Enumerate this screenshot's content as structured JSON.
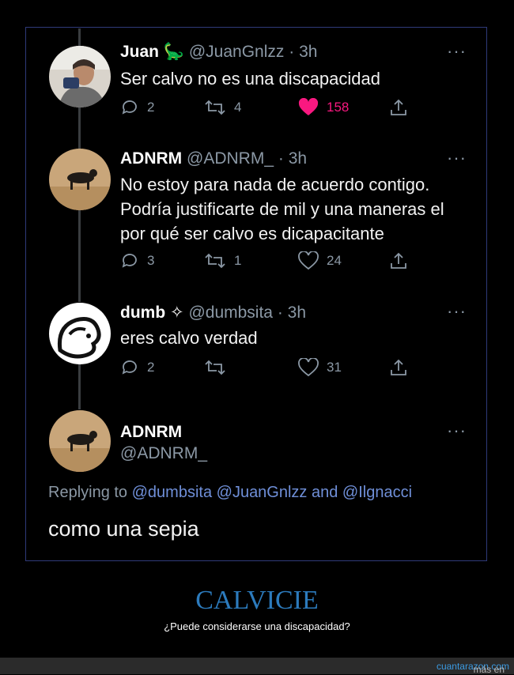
{
  "tweets": [
    {
      "name": "Juan",
      "badge": "🦕",
      "handle": "@JuanGnlzz",
      "time": "3h",
      "text": [
        "Ser calvo no es una discapacidad"
      ],
      "replies": "2",
      "retweets": "4",
      "likes": "158",
      "liked": true
    },
    {
      "name": "ADNRM",
      "handle": "@ADNRM_",
      "time": "3h",
      "text": [
        "No estoy para nada de acuerdo contigo.",
        "Podría justificarte de mil y una maneras el",
        "por qué ser calvo es dicapacitante"
      ],
      "replies": "3",
      "retweets": "1",
      "likes": "24",
      "liked": false
    },
    {
      "name": "dumb",
      "badge": "✧",
      "handle": "@dumbsita",
      "time": "3h",
      "text": [
        "eres calvo verdad"
      ],
      "replies": "2",
      "retweets": "",
      "likes": "31",
      "liked": false
    }
  ],
  "main_tweet": {
    "name": "ADNRM",
    "handle": "@ADNRM_",
    "replying_prefix": "Replying to",
    "replying_users": "@dumbsita @JuanGnlzz and @Ilgnacci",
    "text": "como una sepia"
  },
  "separator": "·",
  "more_label": "···",
  "caption": {
    "title": "CALVICIE",
    "subtitle": "¿Puede considerarse una discapacidad?"
  },
  "footer": {
    "prefix": "más en",
    "link": "cuantarazon.com"
  },
  "colors": {
    "background": "#000000",
    "frame_border": "#2f3a7a",
    "muted": "#8b98a5",
    "like_pink": "#f91880",
    "mention_blue": "#6f8fd8",
    "caption_blue": "#2c7bbd"
  },
  "icons": [
    "reply-icon",
    "retweet-icon",
    "like-icon",
    "share-icon",
    "more-icon"
  ]
}
